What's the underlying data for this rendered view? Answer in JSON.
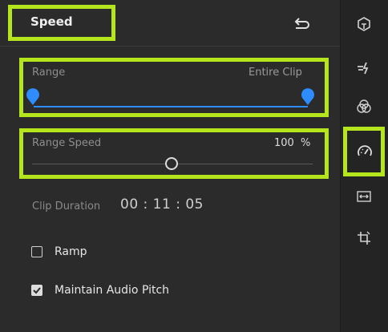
{
  "header": {
    "title": "Speed"
  },
  "range": {
    "label": "Range",
    "value_text": "Entire Clip",
    "start_fraction": 0.0,
    "end_fraction": 1.0
  },
  "range_speed": {
    "label": "Range Speed",
    "value": "100",
    "unit": "%",
    "slider_fraction": 0.5
  },
  "clip_duration": {
    "label": "Clip Duration",
    "value": "00 : 11 : 05"
  },
  "options": [
    {
      "label": "Ramp",
      "checked": false
    },
    {
      "label": "Maintain Audio Pitch",
      "checked": true
    }
  ],
  "rail": {
    "icons": [
      "color-wheel-icon",
      "auto-enhance-icon",
      "color-circles-icon",
      "speed-gauge-icon",
      "stretch-icon",
      "crop-icon"
    ],
    "selected": "speed-gauge-icon"
  },
  "colors": {
    "highlight": "#b5e61d",
    "accent_blue": "#2f8cff",
    "panel_bg": "#2b2b2b"
  }
}
